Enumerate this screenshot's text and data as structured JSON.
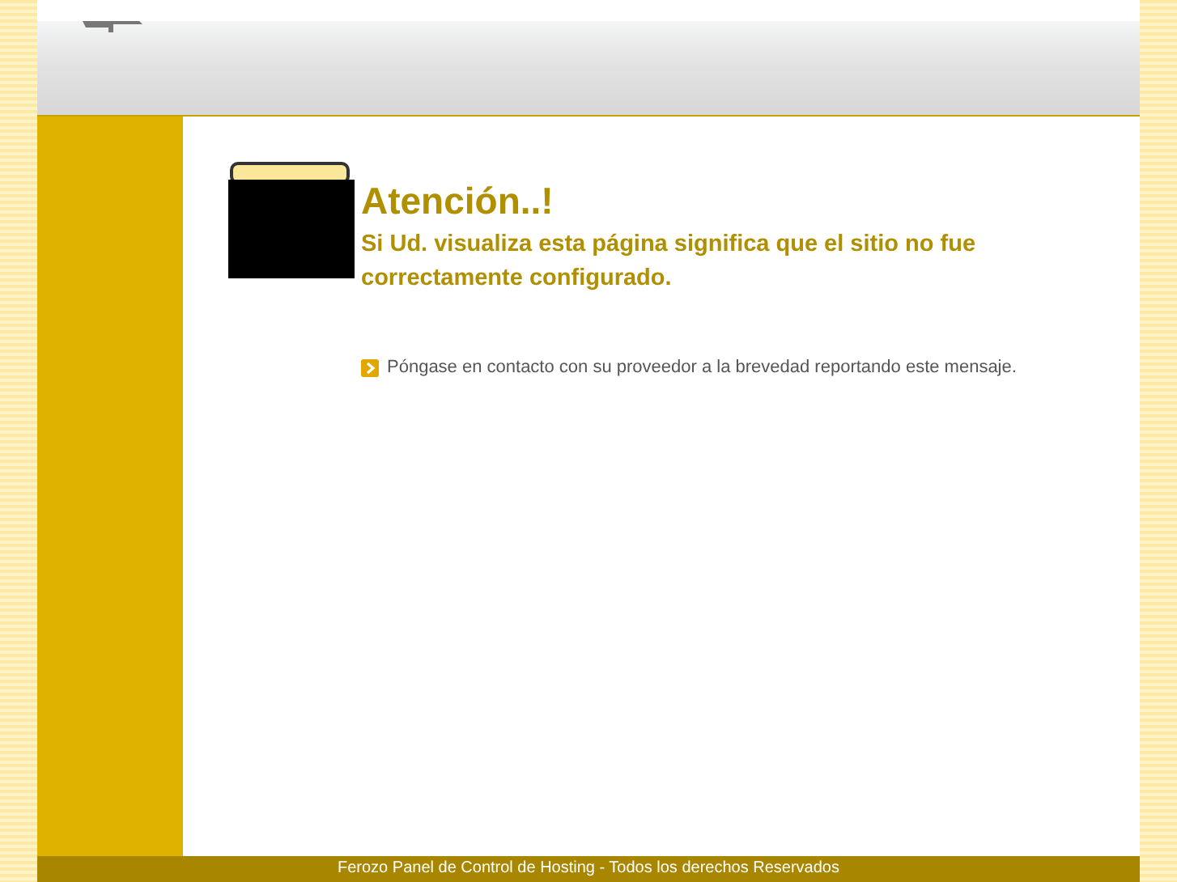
{
  "heading": "Atención..!",
  "message": "Si Ud. visualiza esta página significa que el sitio no fue correctamente configurado.",
  "note": "Póngase en contacto con su proveedor a la brevedad reportando este mensaje.",
  "footer": "Ferozo Panel de Control de Hosting - Todos los derechos Reservados"
}
